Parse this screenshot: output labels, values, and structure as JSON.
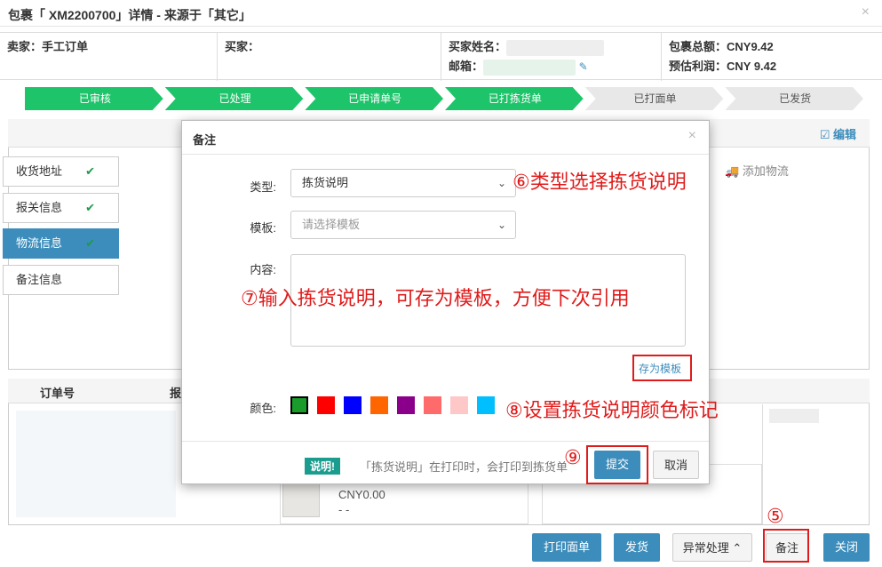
{
  "window": {
    "title": "包裹「 XM2200700」详情 - 来源于「其它」",
    "close": "×"
  },
  "info": {
    "seller": "卖家：手工订单",
    "buyer": "买家：",
    "buyer_name": "买家姓名：",
    "email": "邮箱：",
    "total": "包裹总额：CNY9.42",
    "profit": "预估利润：CNY 9.42"
  },
  "steps": [
    {
      "label": "已审核",
      "done": true
    },
    {
      "label": "已处理",
      "done": true
    },
    {
      "label": "已申请单号",
      "done": true
    },
    {
      "label": "已打拣货单",
      "done": true
    },
    {
      "label": "已打面单",
      "done": false
    },
    {
      "label": "已发货",
      "done": false
    }
  ],
  "colors": {
    "step_done": "#1ec46a",
    "step_todo": "#e8e8e8",
    "accent": "#3c8dbc",
    "annotation": "#e01b1b"
  },
  "side_tabs": [
    {
      "label": "收货地址",
      "check": "✔",
      "active": false
    },
    {
      "label": "报关信息",
      "check": "✔",
      "active": false
    },
    {
      "label": "物流信息",
      "check": "✔",
      "active": true
    },
    {
      "label": "备注信息",
      "check": "",
      "active": false
    }
  ],
  "panel": {
    "edit": "编辑",
    "add_logistics": "添加物流"
  },
  "orders": {
    "col_order": "订单号",
    "col_2": "报",
    "price": "CNY0.00",
    "dash": "- -"
  },
  "modal": {
    "title": "备注",
    "close": "×",
    "type_label": "类型:",
    "type_value": "拣货说明",
    "template_label": "模板:",
    "template_placeholder": "请选择模板",
    "content_label": "内容:",
    "save_template": "存为模板",
    "color_label": "颜色:",
    "swatches": [
      "#1a9c2a",
      "#ff0000",
      "#0000ff",
      "#ff6600",
      "#8b008b",
      "#ff6b6b",
      "#ffc8c8",
      "#00bfff"
    ],
    "tip_badge": "说明!",
    "tip_text": "「拣货说明」在打印时，会打印到拣货单",
    "submit": "提交",
    "cancel": "取消"
  },
  "bottom": {
    "print": "打印面单",
    "ship": "发货",
    "exception": "异常处理",
    "note": "备注",
    "close": "关闭"
  },
  "annotations": {
    "a5": "⑤",
    "a6": "⑥类型选择拣货说明",
    "a7": "⑦输入拣货说明，可存为模板，方便下次引用",
    "a8": "⑧设置拣货说明颜色标记",
    "a9": "⑨"
  }
}
